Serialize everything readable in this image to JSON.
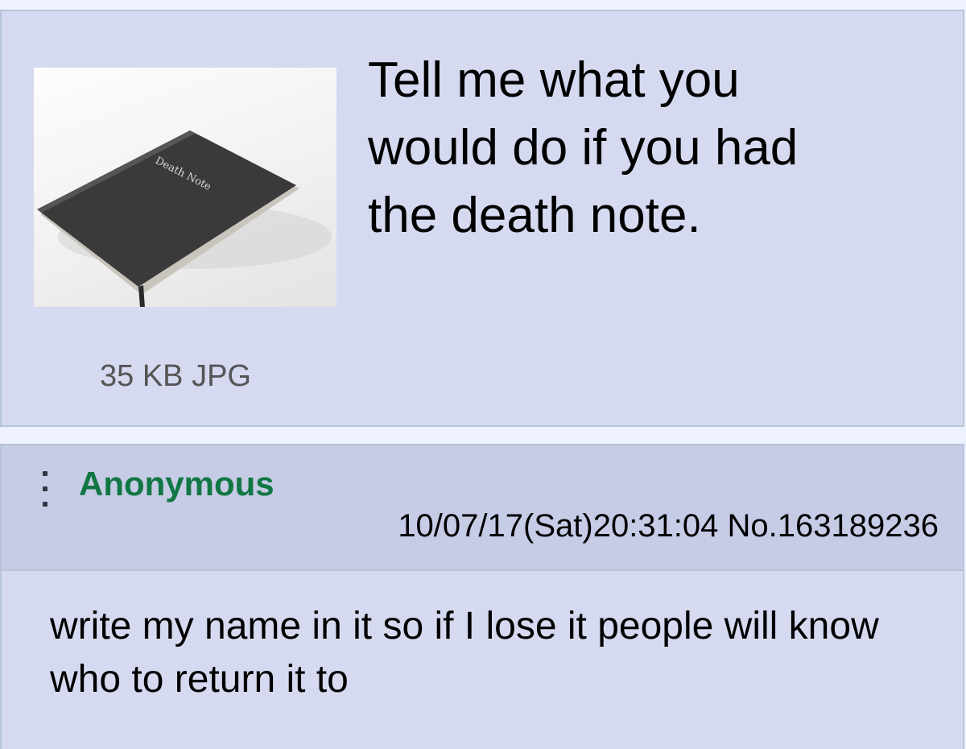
{
  "thread": {
    "op": {
      "subject_text": "Tell me what you\nwould do if you had\nthe death note.",
      "file_info": "35 KB JPG",
      "thumbnail": {
        "cover_text": "Death Note",
        "cover_color": "#3a3a3a"
      }
    },
    "reply": {
      "name": "Anonymous",
      "name_color": "#117743",
      "datetime": "10/07/17(Sat)20:31:04",
      "post_number": "No.163189236",
      "comment": "write my name in it so if I lose it people will know who to return it to",
      "menu_icon": "vertical-ellipsis-icon"
    }
  },
  "colors": {
    "post_background": "#d6daf0",
    "reply_header_background": "#c6cbe6",
    "border": "#b7c5d9",
    "page_background": "#eef2ff"
  }
}
